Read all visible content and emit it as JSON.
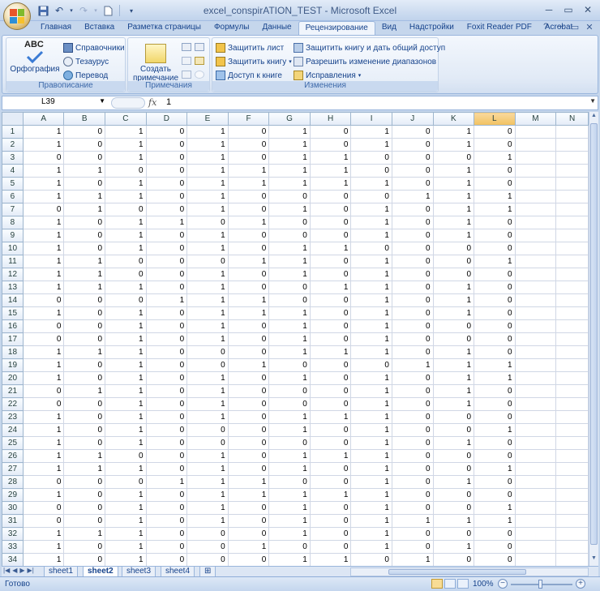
{
  "window": {
    "title": "excel_conspirATION_TEST - Microsoft Excel"
  },
  "ribbon_tabs": [
    "Главная",
    "Вставка",
    "Разметка страницы",
    "Формулы",
    "Данные",
    "Рецензирование",
    "Вид",
    "Надстройки",
    "Foxit Reader PDF",
    "Acrobat"
  ],
  "active_tab": "Рецензирование",
  "ribbon": {
    "spelling": {
      "label": "Правописание",
      "big_button": "Орфография",
      "big_button_icon_text": "ABC",
      "items": [
        "Справочники",
        "Тезаурус",
        "Перевод"
      ]
    },
    "comments": {
      "label": "Примечания",
      "big_button_line1": "Создать",
      "big_button_line2": "примечание"
    },
    "changes": {
      "label": "Изменения",
      "col1": [
        "Защитить лист",
        "Защитить книгу",
        "Доступ к книге"
      ],
      "col2": [
        "Защитить книгу и дать общий доступ",
        "Разрешить изменение диапазонов",
        "Исправления"
      ]
    }
  },
  "formula_bar": {
    "name_box": "L39",
    "fx": "fx",
    "value": "1"
  },
  "columns": [
    "A",
    "B",
    "C",
    "D",
    "E",
    "F",
    "G",
    "H",
    "I",
    "J",
    "K",
    "L",
    "M",
    "N"
  ],
  "selected_column": "L",
  "rows": [
    [
      1,
      0,
      1,
      0,
      1,
      0,
      1,
      0,
      1,
      0,
      1,
      0
    ],
    [
      1,
      0,
      1,
      0,
      1,
      0,
      1,
      0,
      1,
      0,
      1,
      0
    ],
    [
      0,
      0,
      1,
      0,
      1,
      0,
      1,
      1,
      0,
      0,
      0,
      1
    ],
    [
      1,
      1,
      0,
      0,
      1,
      1,
      1,
      1,
      0,
      0,
      1,
      0
    ],
    [
      1,
      0,
      1,
      0,
      1,
      1,
      1,
      1,
      1,
      0,
      1,
      0
    ],
    [
      1,
      1,
      1,
      0,
      1,
      0,
      0,
      0,
      0,
      1,
      1,
      1
    ],
    [
      0,
      1,
      0,
      0,
      1,
      0,
      1,
      0,
      1,
      0,
      1,
      1
    ],
    [
      1,
      0,
      1,
      1,
      0,
      1,
      0,
      0,
      1,
      0,
      1,
      0
    ],
    [
      1,
      0,
      1,
      0,
      1,
      0,
      0,
      0,
      1,
      0,
      1,
      0
    ],
    [
      1,
      0,
      1,
      0,
      1,
      0,
      1,
      1,
      0,
      0,
      0,
      0
    ],
    [
      1,
      1,
      0,
      0,
      0,
      1,
      1,
      0,
      1,
      0,
      0,
      1
    ],
    [
      1,
      1,
      0,
      0,
      1,
      0,
      1,
      0,
      1,
      0,
      0,
      0
    ],
    [
      1,
      1,
      1,
      0,
      1,
      0,
      0,
      1,
      1,
      0,
      1,
      0
    ],
    [
      0,
      0,
      0,
      1,
      1,
      1,
      0,
      0,
      1,
      0,
      1,
      0
    ],
    [
      1,
      0,
      1,
      0,
      1,
      1,
      1,
      0,
      1,
      0,
      1,
      0
    ],
    [
      0,
      0,
      1,
      0,
      1,
      0,
      1,
      0,
      1,
      0,
      0,
      0
    ],
    [
      0,
      0,
      1,
      0,
      1,
      0,
      1,
      0,
      1,
      0,
      0,
      0
    ],
    [
      1,
      1,
      1,
      0,
      0,
      0,
      1,
      1,
      1,
      0,
      1,
      0
    ],
    [
      1,
      0,
      1,
      0,
      0,
      1,
      0,
      0,
      0,
      1,
      1,
      1
    ],
    [
      1,
      0,
      1,
      0,
      1,
      0,
      1,
      0,
      1,
      0,
      1,
      1
    ],
    [
      0,
      1,
      1,
      0,
      1,
      0,
      0,
      0,
      1,
      0,
      1,
      0
    ],
    [
      0,
      0,
      1,
      0,
      1,
      0,
      0,
      0,
      1,
      0,
      1,
      0
    ],
    [
      1,
      0,
      1,
      0,
      1,
      0,
      1,
      1,
      1,
      0,
      0,
      0
    ],
    [
      1,
      0,
      1,
      0,
      0,
      0,
      1,
      0,
      1,
      0,
      0,
      1
    ],
    [
      1,
      0,
      1,
      0,
      0,
      0,
      0,
      0,
      1,
      0,
      1,
      0
    ],
    [
      1,
      1,
      0,
      0,
      1,
      0,
      1,
      1,
      1,
      0,
      0,
      0
    ],
    [
      1,
      1,
      1,
      0,
      1,
      0,
      1,
      0,
      1,
      0,
      0,
      1
    ],
    [
      0,
      0,
      0,
      1,
      1,
      1,
      0,
      0,
      1,
      0,
      1,
      0
    ],
    [
      1,
      0,
      1,
      0,
      1,
      1,
      1,
      1,
      1,
      0,
      0,
      0
    ],
    [
      0,
      0,
      1,
      0,
      1,
      0,
      1,
      0,
      1,
      0,
      0,
      1
    ],
    [
      0,
      0,
      1,
      0,
      1,
      0,
      1,
      0,
      1,
      1,
      1,
      1
    ],
    [
      1,
      1,
      1,
      0,
      0,
      0,
      1,
      0,
      1,
      0,
      0,
      0
    ],
    [
      1,
      0,
      1,
      0,
      0,
      1,
      0,
      0,
      1,
      0,
      1,
      0
    ],
    [
      1,
      0,
      1,
      0,
      0,
      0,
      1,
      1,
      0,
      1,
      0,
      0
    ]
  ],
  "sheet_tabs": [
    "sheet1",
    "sheet2",
    "sheet3",
    "sheet4"
  ],
  "active_sheet": "sheet2",
  "status": {
    "text": "Готово",
    "zoom": "100%"
  },
  "colors": {
    "accent": "#15428b",
    "selected_header": "#f1c15f"
  }
}
